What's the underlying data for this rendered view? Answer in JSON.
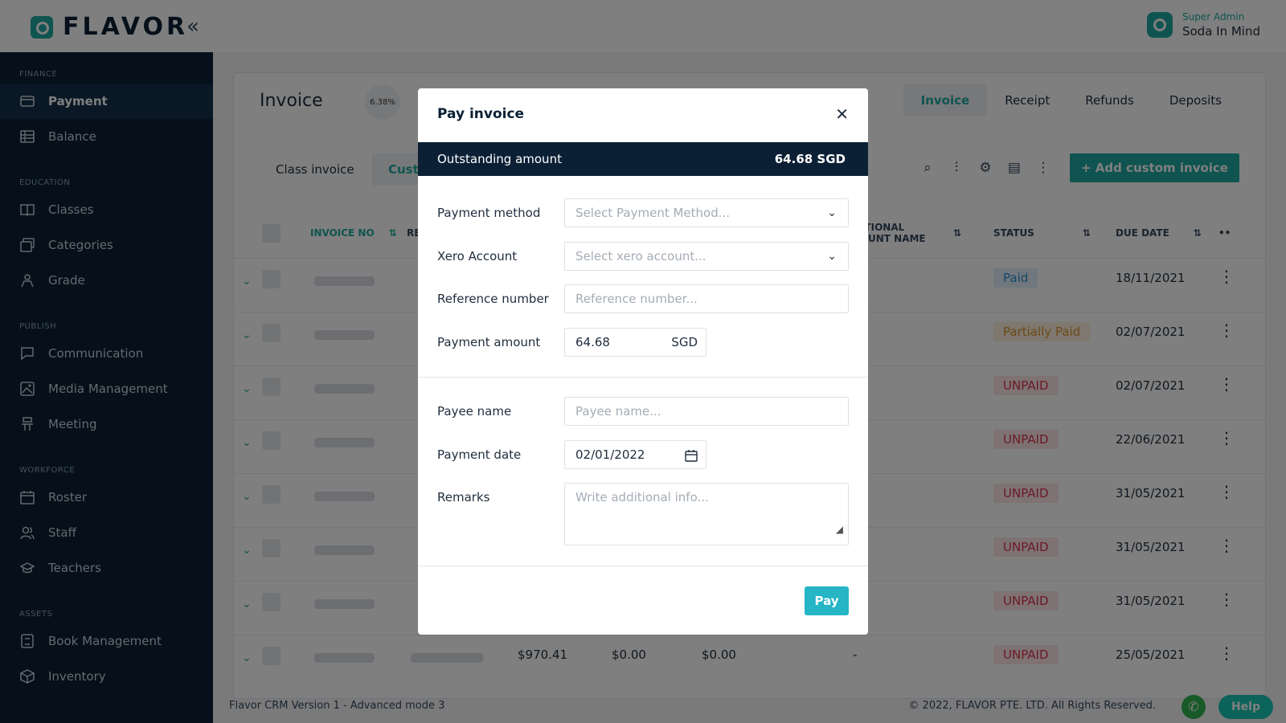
{
  "header": {
    "brand": "FLAVOR",
    "user_role": "Super Admin",
    "user_name": "Soda In Mind"
  },
  "sidebar": {
    "sections": [
      {
        "title": "FINANCE",
        "items": [
          {
            "label": "Payment",
            "icon": "card-icon",
            "active": true
          },
          {
            "label": "Balance",
            "icon": "balance-icon"
          }
        ]
      },
      {
        "title": "EDUCATION",
        "items": [
          {
            "label": "Classes",
            "icon": "book-icon"
          },
          {
            "label": "Categories",
            "icon": "categories-icon"
          },
          {
            "label": "Grade",
            "icon": "grade-icon"
          }
        ]
      },
      {
        "title": "PUBLISH",
        "items": [
          {
            "label": "Communication",
            "icon": "chat-icon"
          },
          {
            "label": "Media Management",
            "icon": "media-icon"
          },
          {
            "label": "Meeting",
            "icon": "meeting-icon"
          }
        ]
      },
      {
        "title": "WORKFORCE",
        "items": [
          {
            "label": "Roster",
            "icon": "calendar-icon"
          },
          {
            "label": "Staff",
            "icon": "users-icon"
          },
          {
            "label": "Teachers",
            "icon": "graduation-icon"
          }
        ]
      },
      {
        "title": "ASSETS",
        "items": [
          {
            "label": "Book Management",
            "icon": "book-management-icon"
          },
          {
            "label": "Inventory",
            "icon": "inventory-icon"
          }
        ]
      }
    ]
  },
  "main": {
    "title": "Invoice",
    "progress": "6.38%",
    "tabs": [
      "Invoice",
      "Receipt",
      "Refunds",
      "Deposits"
    ],
    "active_tab": "Invoice",
    "sub_tabs": [
      "Class invoice",
      "Custo"
    ],
    "add_button": "+ Add custom invoice",
    "columns": {
      "invoice_no": "INVOICE NO",
      "re": "RE",
      "additional_1": "DITIONAL",
      "additional_2": "COUNT NAME",
      "status": "STATUS",
      "due_date": "DUE DATE"
    },
    "rows": [
      {
        "status": "Paid",
        "status_type": "paid",
        "due": "18/11/2021"
      },
      {
        "status": "Partially Paid",
        "status_type": "partial",
        "due": "02/07/2021"
      },
      {
        "status": "UNPAID",
        "status_type": "unpaid",
        "due": "02/07/2021"
      },
      {
        "status": "UNPAID",
        "status_type": "unpaid",
        "due": "22/06/2021"
      },
      {
        "status": "UNPAID",
        "status_type": "unpaid",
        "due": "31/05/2021"
      },
      {
        "status": "UNPAID",
        "status_type": "unpaid",
        "due": "31/05/2021"
      },
      {
        "status": "UNPAID",
        "status_type": "unpaid",
        "due": "31/05/2021"
      },
      {
        "status": "UNPAID",
        "status_type": "unpaid",
        "due": "25/05/2021",
        "amount": "$970.41",
        "col2": "$0.00",
        "col3": "$0.00",
        "col4": "-"
      }
    ]
  },
  "footer": {
    "version": "Flavor CRM Version 1 - Advanced mode 3",
    "copyright": "© 2022, FLAVOR PTE. LTD. All Rights Reserved.",
    "help": "Help"
  },
  "modal": {
    "title": "Pay invoice",
    "outstanding_label": "Outstanding amount",
    "outstanding_amount": "64.68 SGD",
    "payment_method_label": "Payment method",
    "payment_method_placeholder": "Select Payment Method...",
    "xero_label": "Xero Account",
    "xero_placeholder": "Select xero account...",
    "reference_label": "Reference number",
    "reference_placeholder": "Reference number...",
    "amount_label": "Payment amount",
    "amount_value": "64.68",
    "amount_currency": "SGD",
    "payee_label": "Payee name",
    "payee_placeholder": "Payee name...",
    "date_label": "Payment date",
    "date_value": "02/01/2022",
    "remarks_label": "Remarks",
    "remarks_placeholder": "Write additional info...",
    "pay_button": "Pay"
  }
}
